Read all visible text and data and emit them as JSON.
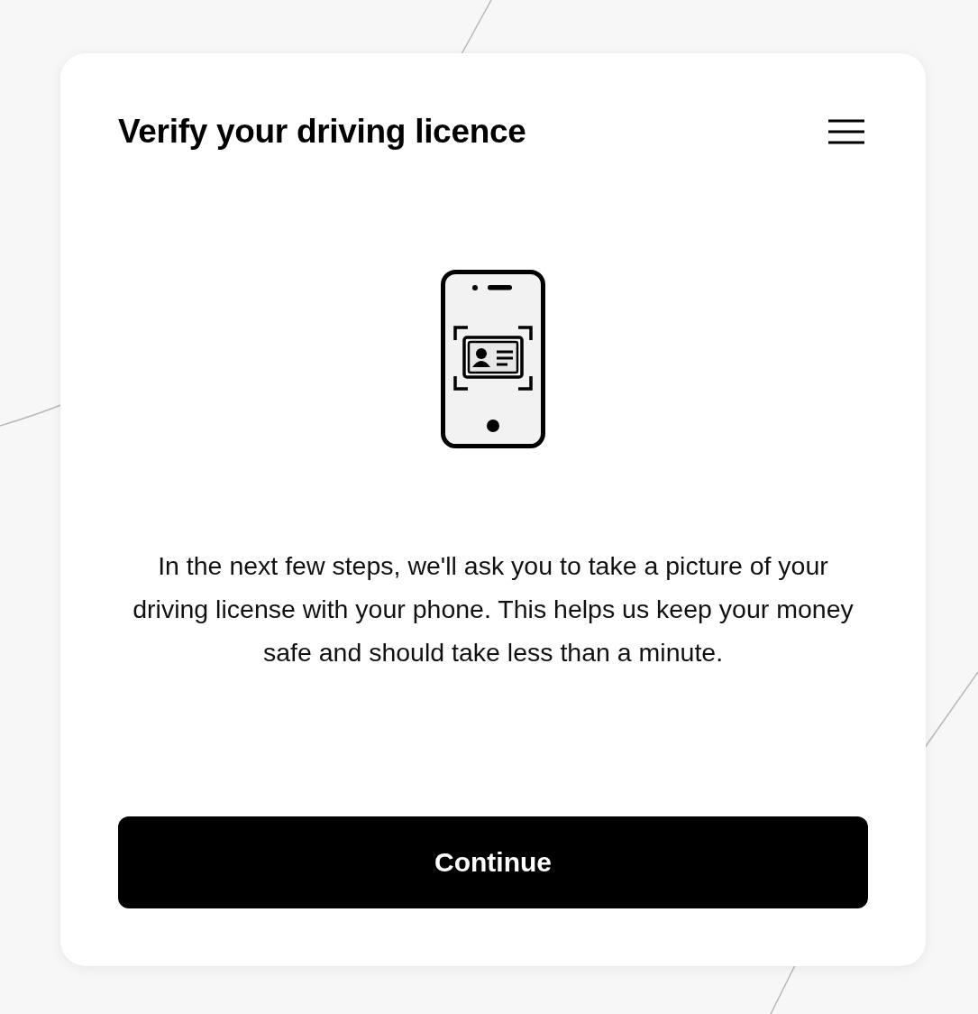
{
  "card": {
    "title": "Verify your driving licence",
    "paragraph": "In the next few steps, we'll ask you to take a picture of your driving license with your phone. This helps us keep your money safe and should take less than a minute.",
    "button": "Continue"
  }
}
